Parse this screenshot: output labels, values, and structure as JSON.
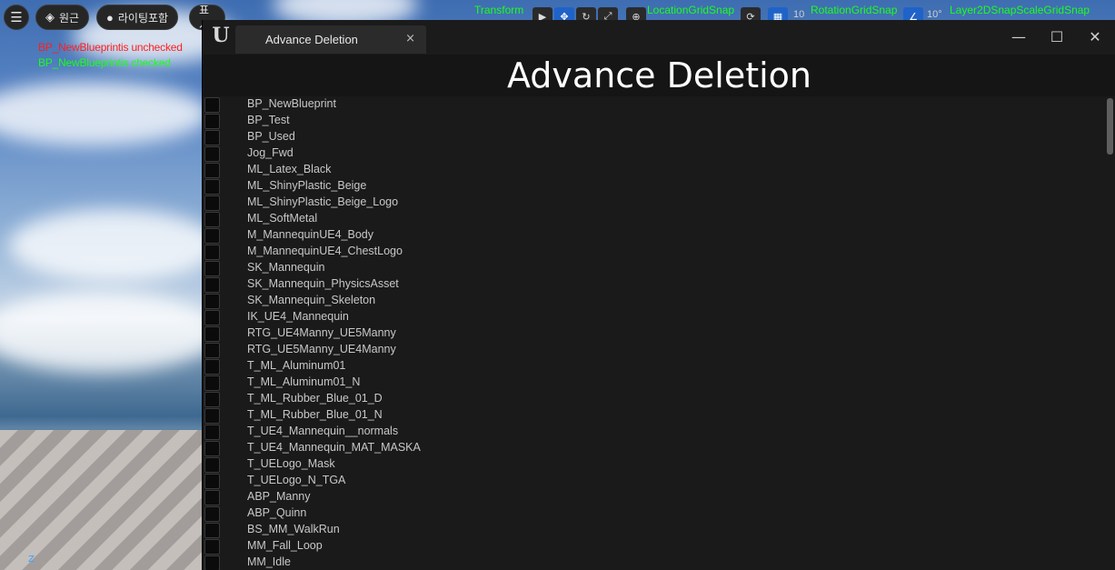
{
  "toolbar": {
    "menu_icon": "hamburger-icon",
    "perspective_label": "원근",
    "lighting_label": "라이팅포함",
    "show_label": "표시",
    "transform_label": "Transform",
    "location_snap_label": "LocationGridSnap",
    "rotation_snap_label": "RotationGridSnap",
    "rotation_value": "10°",
    "grid_value": "10",
    "scale_snap_label": "Layer2DSnapScaleGridSnap"
  },
  "debug": {
    "unchecked_msg": "BP_NewBlueprintis unchecked",
    "checked_msg": "BP_NewBlueprintis checked"
  },
  "viewport": {
    "axis_label": "Z"
  },
  "window": {
    "tab_title": "Advance Deletion",
    "tab_close": "×",
    "heading": "Advance Deletion",
    "minimize": "—",
    "maximize": "☐",
    "close": "✕"
  },
  "assets": [
    "BP_NewBlueprint",
    "BP_Test",
    "BP_Used",
    "Jog_Fwd",
    "ML_Latex_Black",
    "ML_ShinyPlastic_Beige",
    "ML_ShinyPlastic_Beige_Logo",
    "ML_SoftMetal",
    "M_MannequinUE4_Body",
    "M_MannequinUE4_ChestLogo",
    "SK_Mannequin",
    "SK_Mannequin_PhysicsAsset",
    "SK_Mannequin_Skeleton",
    "IK_UE4_Mannequin",
    "RTG_UE4Manny_UE5Manny",
    "RTG_UE5Manny_UE4Manny",
    "T_ML_Aluminum01",
    "T_ML_Aluminum01_N",
    "T_ML_Rubber_Blue_01_D",
    "T_ML_Rubber_Blue_01_N",
    "T_UE4_Mannequin__normals",
    "T_UE4_Mannequin_MAT_MASKA",
    "T_UELogo_Mask",
    "T_UELogo_N_TGA",
    "ABP_Manny",
    "ABP_Quinn",
    "BS_MM_WalkRun",
    "MM_Fall_Loop",
    "MM_Idle"
  ]
}
